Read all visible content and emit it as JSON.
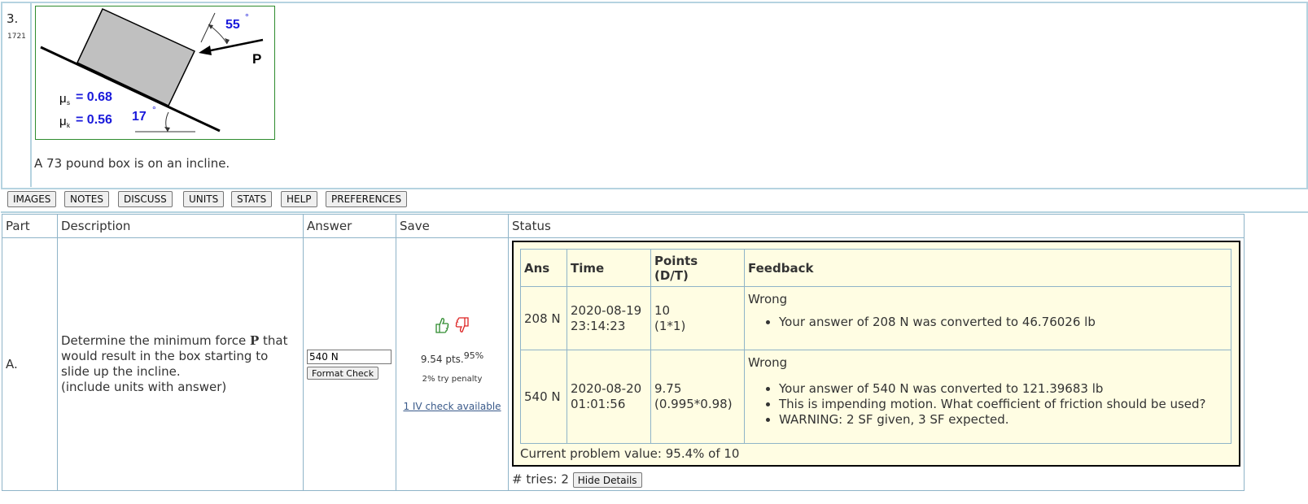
{
  "question": {
    "number": "3.",
    "id": "1721",
    "text": "A 73 pound box is on an incline.",
    "figure": {
      "angle_p": "55",
      "degree_mark": "°",
      "force_label": "P",
      "mu_s_label": "μ",
      "mu_s_sub": "s",
      "mu_s_value": "= 0.68",
      "mu_k_label": "μ",
      "mu_k_sub": "k",
      "mu_k_value": "= 0.56",
      "incline_angle": "17"
    }
  },
  "toolbar": [
    "IMAGES",
    "NOTES",
    "DISCUSS",
    "UNITS",
    "STATS",
    "HELP",
    "PREFERENCES"
  ],
  "parts_table": {
    "headers": [
      "Part",
      "Description",
      "Answer",
      "Save",
      "Status"
    ],
    "part_label": "A.",
    "description": {
      "line1_before": "Determine the minimum force ",
      "line1_bold": "P",
      "line1_after": " that",
      "line2": "would result in the box starting to",
      "line3": "slide up the incline.",
      "line4": "(include units with answer)"
    },
    "answer_value": "540 N",
    "format_check_label": "Format Check",
    "save": {
      "points": "9.54 pts.",
      "percent": "95%",
      "penalty": "2% try penalty",
      "iv_link": "1 IV check available"
    }
  },
  "feedback_table": {
    "headers": [
      "Ans",
      "Time",
      "Points\n(D/T)",
      "Feedback"
    ],
    "header_points_line1": "Points",
    "header_points_line2": "(D/T)",
    "rows": [
      {
        "ans": "208 N",
        "date": "2020-08-19",
        "time": "23:14:23",
        "points": "10",
        "points_calc": "(1*1)",
        "verdict": "Wrong",
        "notes": [
          "Your answer of 208 N was converted to 46.76026 lb"
        ]
      },
      {
        "ans": "540 N",
        "date": "2020-08-20",
        "time": "01:01:56",
        "points": "9.75",
        "points_calc": "(0.995*0.98)",
        "verdict": "Wrong",
        "notes": [
          "Your answer of 540 N was converted to 121.39683 lb",
          "This is impending motion. What coefficient of friction should be used?",
          "WARNING: 2 SF given, 3 SF expected."
        ]
      }
    ],
    "current_value": "Current problem value: 95.4% of 10"
  },
  "tries": {
    "label": "# tries: 2",
    "hide_details": "Hide Details"
  },
  "colors": {
    "frame_border": "#b5d3e0",
    "figure_border": "#2e8b2e",
    "value_blue": "#1a1adb",
    "status_bg": "#fffde3",
    "thumb_up": "#2e8b2e",
    "thumb_down": "#d22"
  }
}
